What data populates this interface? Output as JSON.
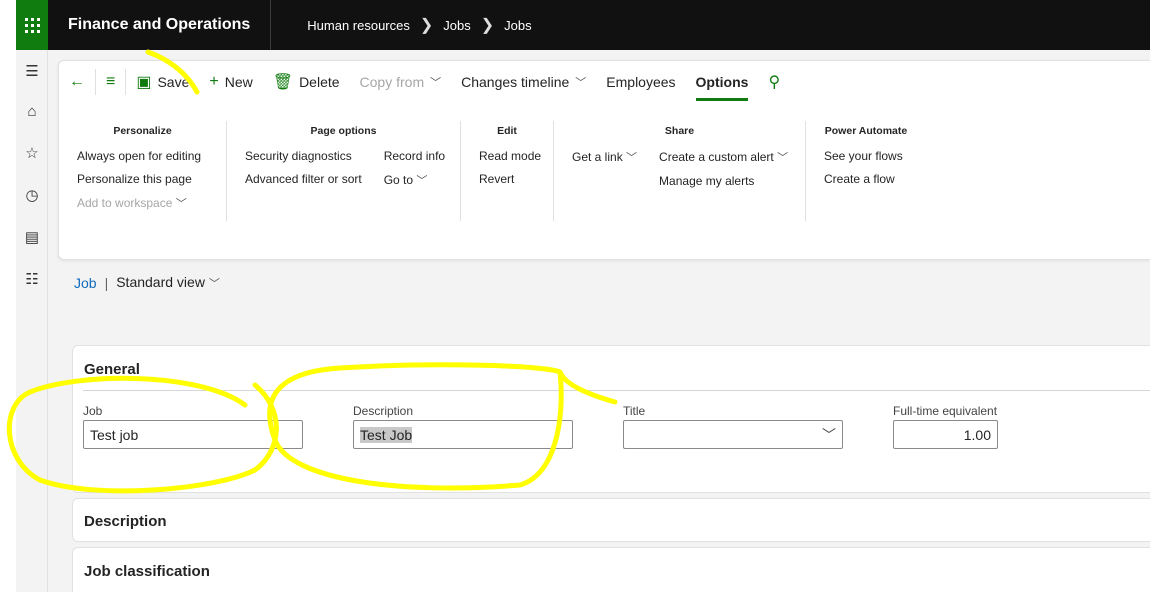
{
  "app": {
    "title": "Finance and Operations"
  },
  "breadcrumb": [
    "Human resources",
    "Jobs",
    "Jobs"
  ],
  "commands": {
    "save": "Save",
    "new": "New",
    "delete": "Delete",
    "copy_from": "Copy from",
    "changes_timeline": "Changes timeline",
    "employees": "Employees",
    "options": "Options"
  },
  "groups": {
    "personalize": {
      "title": "Personalize",
      "items": [
        "Always open for editing",
        "Personalize this page",
        "Add to workspace"
      ]
    },
    "page_options": {
      "title": "Page options",
      "col1": [
        "Security diagnostics",
        "Advanced filter or sort"
      ],
      "col2": [
        "Record info",
        "Go to"
      ]
    },
    "edit": {
      "title": "Edit",
      "items": [
        "Read mode",
        "Revert"
      ]
    },
    "share": {
      "title": "Share",
      "col1": [
        "Get a link"
      ],
      "col2": [
        "Create a custom alert",
        "Manage my alerts"
      ]
    },
    "power_automate": {
      "title": "Power Automate",
      "items": [
        "See your flows",
        "Create a flow"
      ]
    }
  },
  "view": {
    "entity": "Job",
    "separator": "|",
    "name": "Standard view"
  },
  "general": {
    "title": "General",
    "fields": {
      "job": {
        "label": "Job",
        "value": "Test job"
      },
      "description": {
        "label": "Description",
        "value": "Test Job"
      },
      "title": {
        "label": "Title",
        "value": ""
      },
      "fte": {
        "label": "Full-time equivalent",
        "value": "1.00"
      }
    }
  },
  "sections": {
    "description": "Description",
    "job_classification": "Job classification"
  },
  "colors": {
    "brand_green": "#107c10",
    "topbar": "#111111",
    "link": "#0f6cbd",
    "highlight": "#ffff00"
  }
}
